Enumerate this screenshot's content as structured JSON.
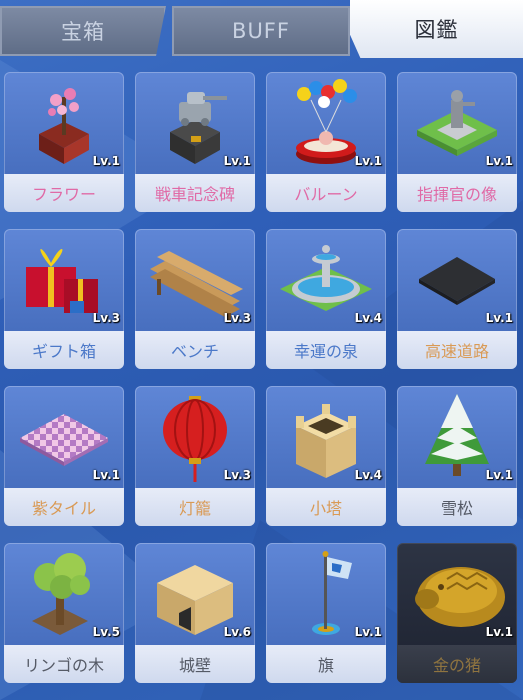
{
  "tabs": [
    {
      "label": "宝箱",
      "active": false
    },
    {
      "label": "BUFF",
      "active": false
    },
    {
      "label": "図鑑",
      "active": true
    }
  ],
  "items": [
    {
      "name": "フラワー",
      "level": "Lv.1",
      "icon": "flower-pot-icon",
      "color": "#e06aa6"
    },
    {
      "name": "戦車記念碑",
      "level": "Lv.1",
      "icon": "tank-monument-icon",
      "color": "#e06aa6"
    },
    {
      "name": "バルーン",
      "level": "Lv.1",
      "icon": "balloon-icon",
      "color": "#e06aa6"
    },
    {
      "name": "指揮官の像",
      "level": "Lv.1",
      "icon": "commander-statue-icon",
      "color": "#e06aa6"
    },
    {
      "name": "ギフト箱",
      "level": "Lv.3",
      "icon": "gift-box-icon",
      "color": "#4c79c9"
    },
    {
      "name": "ベンチ",
      "level": "Lv.3",
      "icon": "bench-icon",
      "color": "#4c79c9"
    },
    {
      "name": "幸運の泉",
      "level": "Lv.4",
      "icon": "fountain-icon",
      "color": "#4c79c9"
    },
    {
      "name": "高速道路",
      "level": "Lv.1",
      "icon": "road-tile-icon",
      "color": "#d99a55"
    },
    {
      "name": "紫タイル",
      "level": "Lv.1",
      "icon": "purple-tile-icon",
      "color": "#d99a55"
    },
    {
      "name": "灯籠",
      "level": "Lv.3",
      "icon": "lantern-icon",
      "color": "#d99a55"
    },
    {
      "name": "小塔",
      "level": "Lv.4",
      "icon": "small-tower-icon",
      "color": "#d99a55"
    },
    {
      "name": "雪松",
      "level": "Lv.1",
      "icon": "snow-pine-icon",
      "color": "#555a66"
    },
    {
      "name": "リンゴの木",
      "level": "Lv.5",
      "icon": "apple-tree-icon",
      "color": "#555a66"
    },
    {
      "name": "城壁",
      "level": "Lv.6",
      "icon": "castle-wall-icon",
      "color": "#555a66"
    },
    {
      "name": "旗",
      "level": "Lv.1",
      "icon": "flag-icon",
      "color": "#555a66"
    },
    {
      "name": "金の猪",
      "level": "Lv.1",
      "icon": "golden-boar-icon",
      "color": "#8f7440"
    }
  ]
}
